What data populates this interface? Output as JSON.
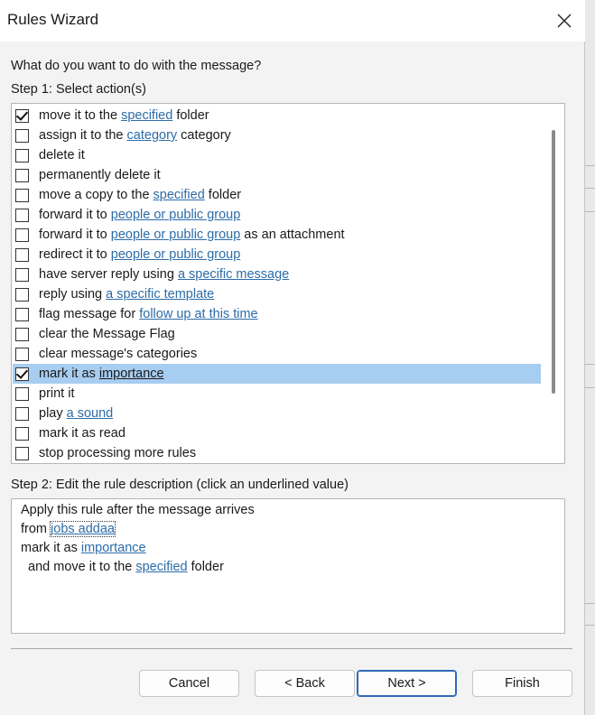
{
  "window": {
    "title": "Rules Wizard"
  },
  "prompt": "What do you want to do with the message?",
  "step1": {
    "label": "Step 1: Select action(s)",
    "actions": [
      {
        "checked": true,
        "selected": false,
        "parts": [
          {
            "t": "move it to the "
          },
          {
            "t": "specified",
            "link": true
          },
          {
            "t": " folder"
          }
        ]
      },
      {
        "checked": false,
        "selected": false,
        "parts": [
          {
            "t": "assign it to the "
          },
          {
            "t": "category",
            "link": true
          },
          {
            "t": " category"
          }
        ]
      },
      {
        "checked": false,
        "selected": false,
        "parts": [
          {
            "t": "delete it"
          }
        ]
      },
      {
        "checked": false,
        "selected": false,
        "parts": [
          {
            "t": "permanently delete it"
          }
        ]
      },
      {
        "checked": false,
        "selected": false,
        "parts": [
          {
            "t": "move a copy to the "
          },
          {
            "t": "specified",
            "link": true
          },
          {
            "t": " folder"
          }
        ]
      },
      {
        "checked": false,
        "selected": false,
        "parts": [
          {
            "t": "forward it to "
          },
          {
            "t": "people or public group",
            "link": true
          }
        ]
      },
      {
        "checked": false,
        "selected": false,
        "parts": [
          {
            "t": "forward it to "
          },
          {
            "t": "people or public group",
            "link": true
          },
          {
            "t": " as an attachment"
          }
        ]
      },
      {
        "checked": false,
        "selected": false,
        "parts": [
          {
            "t": "redirect it to "
          },
          {
            "t": "people or public group",
            "link": true
          }
        ]
      },
      {
        "checked": false,
        "selected": false,
        "parts": [
          {
            "t": "have server reply using "
          },
          {
            "t": "a specific message",
            "link": true
          }
        ]
      },
      {
        "checked": false,
        "selected": false,
        "parts": [
          {
            "t": "reply using "
          },
          {
            "t": "a specific template",
            "link": true
          }
        ]
      },
      {
        "checked": false,
        "selected": false,
        "parts": [
          {
            "t": "flag message for "
          },
          {
            "t": "follow up at this time",
            "link": true
          }
        ]
      },
      {
        "checked": false,
        "selected": false,
        "parts": [
          {
            "t": "clear the Message Flag"
          }
        ]
      },
      {
        "checked": false,
        "selected": false,
        "parts": [
          {
            "t": "clear message's categories"
          }
        ]
      },
      {
        "checked": true,
        "selected": true,
        "parts": [
          {
            "t": "mark it as "
          },
          {
            "t": "importance",
            "link": true
          }
        ]
      },
      {
        "checked": false,
        "selected": false,
        "parts": [
          {
            "t": "print it"
          }
        ]
      },
      {
        "checked": false,
        "selected": false,
        "parts": [
          {
            "t": "play "
          },
          {
            "t": "a sound",
            "link": true
          }
        ]
      },
      {
        "checked": false,
        "selected": false,
        "parts": [
          {
            "t": "mark it as read"
          }
        ]
      },
      {
        "checked": false,
        "selected": false,
        "parts": [
          {
            "t": "stop processing more rules"
          }
        ]
      }
    ]
  },
  "step2": {
    "label": "Step 2: Edit the rule description (click an underlined value)",
    "lines": [
      {
        "parts": [
          {
            "t": "Apply this rule after the message arrives"
          }
        ]
      },
      {
        "parts": [
          {
            "t": "from "
          },
          {
            "t": "jobs addaa",
            "link": true,
            "focused": true
          }
        ]
      },
      {
        "parts": [
          {
            "t": "mark it as "
          },
          {
            "t": "importance",
            "link": true
          }
        ]
      },
      {
        "parts": [
          {
            "t": "  and move it to the "
          },
          {
            "t": "specified",
            "link": true
          },
          {
            "t": " folder"
          }
        ]
      }
    ]
  },
  "buttons": {
    "cancel": "Cancel",
    "back": "< Back",
    "next": "Next >",
    "finish": "Finish"
  },
  "colors": {
    "link": "#2c6ca8",
    "selection": "#a7cdf0",
    "default_button_border": "#2f6ab8"
  },
  "icons": {
    "close": "close-icon",
    "checkmark": "checkmark-icon"
  }
}
